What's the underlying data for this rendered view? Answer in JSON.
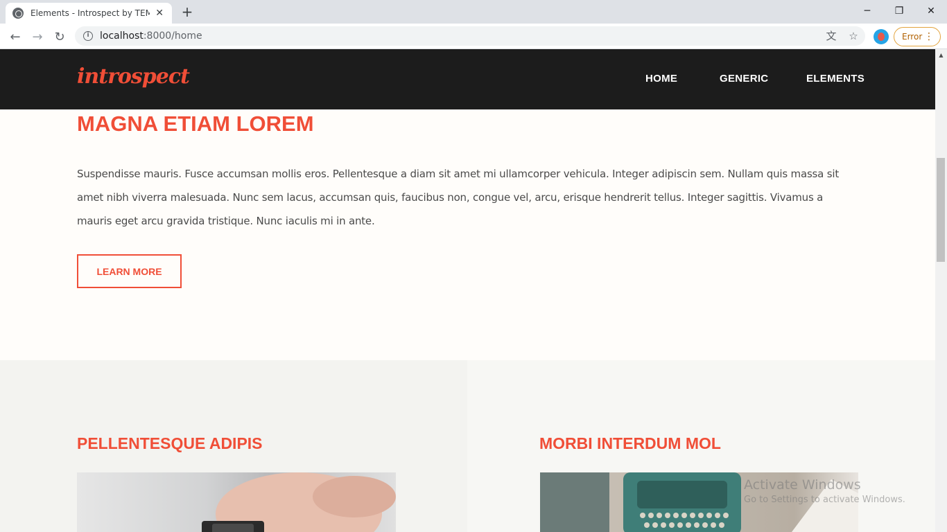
{
  "browser": {
    "tab_title": "Elements - Introspect by TEMPLATED",
    "url_host": "localhost",
    "url_path": ":8000/home",
    "error_label": "Error",
    "new_tab_symbol": "+"
  },
  "site": {
    "logo": "introspect",
    "nav": [
      "HOME",
      "GENERIC",
      "ELEMENTS"
    ]
  },
  "intro": {
    "heading": "MAGNA ETIAM LOREM",
    "body": "Suspendisse mauris. Fusce accumsan mollis eros. Pellentesque a diam sit amet mi ullamcorper vehicula. Integer adipiscin sem. Nullam quis massa sit amet nibh viverra malesuada. Nunc sem lacus, accumsan quis, faucibus non, congue vel, arcu, erisque hendrerit tellus. Integer sagittis. Vivamus a mauris eget arcu gravida tristique. Nunc iaculis mi in ante.",
    "button": "LEARN MORE"
  },
  "columns": [
    {
      "heading": "PELLENTESQUE ADIPIS"
    },
    {
      "heading": "MORBI INTERDUM MOL"
    }
  ],
  "watermark": {
    "title": "Activate Windows",
    "subtitle": "Go to Settings to activate Windows."
  },
  "colors": {
    "accent": "#f04e37",
    "header_bg": "#1c1c1c",
    "page_bg": "#fffdfa"
  }
}
